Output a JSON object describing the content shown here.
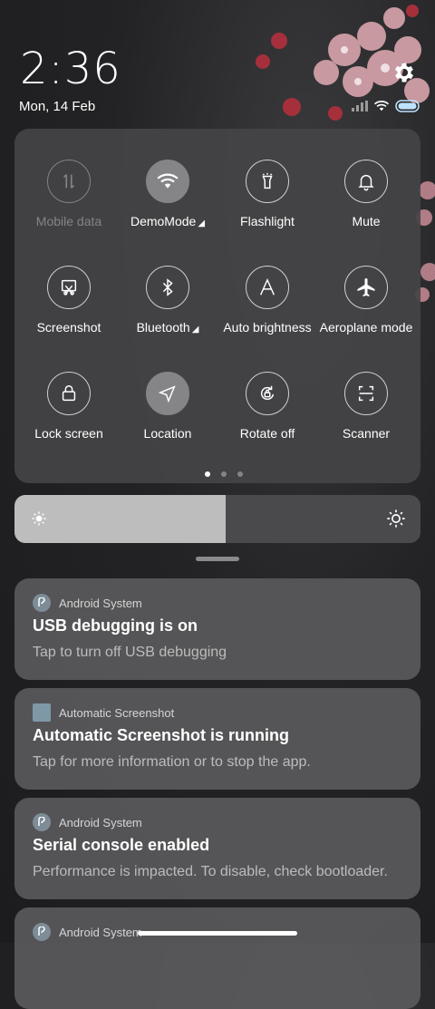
{
  "status": {
    "time": "2:36",
    "date": "Mon, 14 Feb"
  },
  "quick_settings": {
    "tiles": [
      {
        "label": "Mobile data",
        "icon": "mobile-data-icon",
        "state": "disabled"
      },
      {
        "label": "DemoMode",
        "icon": "wifi-icon",
        "state": "active",
        "expand": "◢"
      },
      {
        "label": "Flashlight",
        "icon": "flashlight-icon",
        "state": "off"
      },
      {
        "label": "Mute",
        "icon": "bell-icon",
        "state": "off"
      },
      {
        "label": "Screenshot",
        "icon": "screenshot-icon",
        "state": "off"
      },
      {
        "label": "Bluetooth",
        "icon": "bluetooth-icon",
        "state": "off",
        "expand": "◢"
      },
      {
        "label": "Auto brightness",
        "icon": "auto-brightness-icon",
        "state": "off"
      },
      {
        "label": "Aeroplane mode",
        "icon": "aeroplane-icon",
        "state": "off"
      },
      {
        "label": "Lock screen",
        "icon": "lock-icon",
        "state": "off"
      },
      {
        "label": "Location",
        "icon": "location-icon",
        "state": "active"
      },
      {
        "label": "Rotate off",
        "icon": "rotate-icon",
        "state": "off"
      },
      {
        "label": "Scanner",
        "icon": "scanner-icon",
        "state": "off"
      }
    ],
    "page_count": 3,
    "current_page": 1
  },
  "brightness": {
    "level": 0.52
  },
  "notifications": [
    {
      "app": "Android System",
      "title": "USB debugging is on",
      "text": "Tap to turn off USB debugging"
    },
    {
      "app": "Automatic Screenshot",
      "title": "Automatic Screenshot is running",
      "text": "Tap for more information or to stop the app."
    },
    {
      "app": "Android System",
      "title": "Serial console enabled",
      "text": "Performance is impacted. To disable, check bootloader."
    },
    {
      "app": "Android System"
    }
  ],
  "colors": {
    "panel": "#444446",
    "active_tile": "#858587",
    "brightness_fill": "#bdbdbd"
  }
}
